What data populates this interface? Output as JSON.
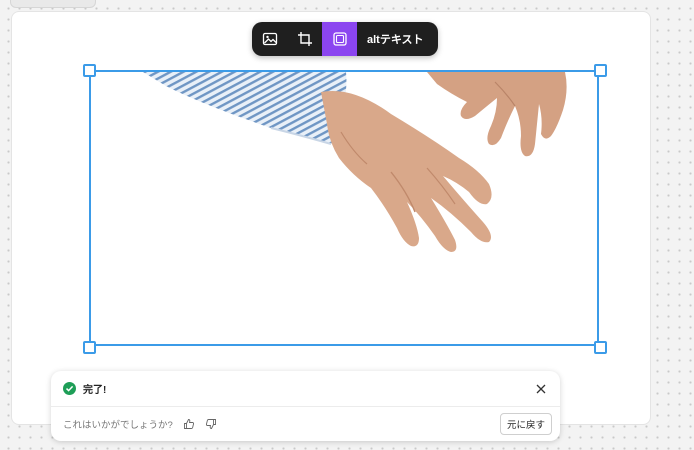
{
  "toolbar": {
    "items": [
      {
        "icon": "image-icon",
        "active": false
      },
      {
        "icon": "crop-icon",
        "active": false
      },
      {
        "icon": "frame-icon",
        "active": true
      }
    ],
    "alt_label": "altテキスト",
    "accent_color": "#8b45f0"
  },
  "selection_color": "#3b9be8",
  "image": {
    "subject": "hands"
  },
  "toast": {
    "status_icon": "check-circle-icon",
    "status_color": "#1e9e57",
    "message": "完了!",
    "feedback_question": "これはいかがでしょうか?",
    "undo_label": "元に戻す"
  }
}
